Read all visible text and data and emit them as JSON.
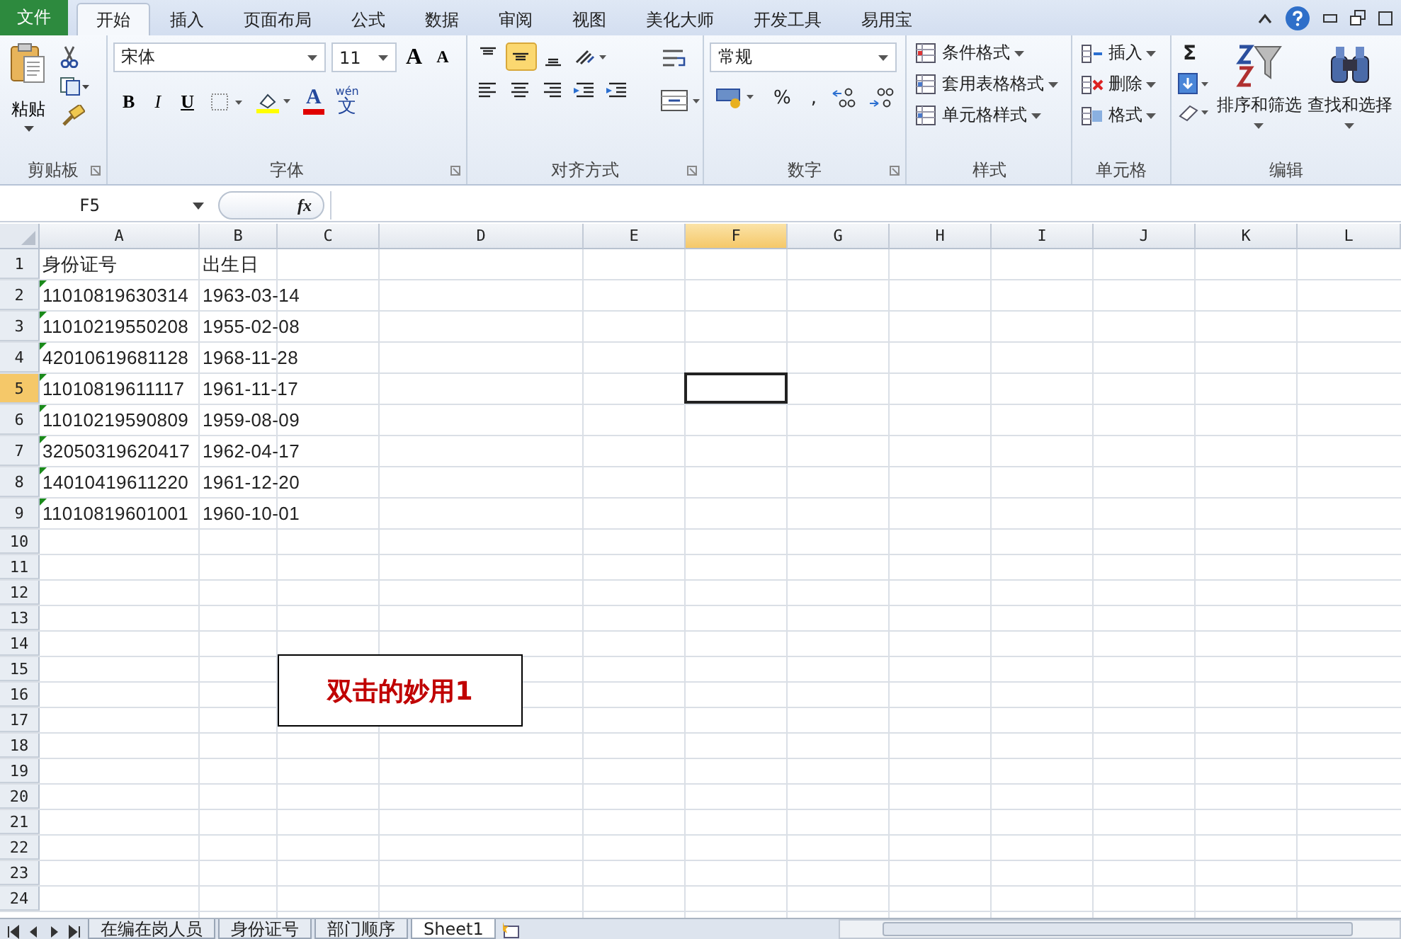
{
  "menu_tabs": [
    {
      "label": "文件",
      "kind": "file",
      "selected": false
    },
    {
      "label": "开始",
      "kind": "tab",
      "selected": true
    },
    {
      "label": "插入",
      "kind": "tab",
      "selected": false
    },
    {
      "label": "页面布局",
      "kind": "tab",
      "selected": false
    },
    {
      "label": "公式",
      "kind": "tab",
      "selected": false
    },
    {
      "label": "数据",
      "kind": "tab",
      "selected": false
    },
    {
      "label": "审阅",
      "kind": "tab",
      "selected": false
    },
    {
      "label": "视图",
      "kind": "tab",
      "selected": false
    },
    {
      "label": "美化大师",
      "kind": "tab",
      "selected": false
    },
    {
      "label": "开发工具",
      "kind": "tab",
      "selected": false
    },
    {
      "label": "易用宝",
      "kind": "tab",
      "selected": false
    }
  ],
  "ribbon": {
    "clipboard": {
      "paste": "粘贴",
      "label": "剪贴板"
    },
    "font": {
      "font_name": "宋体",
      "font_size": "11",
      "grow_shrink": [
        "A",
        "A"
      ],
      "style_buttons": [
        "B",
        "I",
        "U"
      ],
      "font_color_letter": "A",
      "phonetic_top": "wén",
      "phonetic_char": "文",
      "label": "字体"
    },
    "alignment": {
      "rows": [
        [
          {
            "kind": "top",
            "selected": false
          },
          {
            "kind": "middle",
            "selected": true
          },
          {
            "kind": "bottom",
            "selected": false
          },
          {
            "kind": "orientation",
            "selected": false
          }
        ],
        [
          {
            "kind": "left",
            "selected": false
          },
          {
            "kind": "center",
            "selected": false
          },
          {
            "kind": "right",
            "selected": false
          },
          {
            "kind": "outdent",
            "selected": false
          },
          {
            "kind": "indent",
            "selected": false
          }
        ]
      ],
      "label": "对齐方式"
    },
    "number": {
      "format": "常规",
      "symbols": [
        "%",
        ","
      ],
      "label": "数字"
    },
    "styles": {
      "items": [
        "条件格式",
        "套用表格格式",
        "单元格样式"
      ],
      "label": "样式"
    },
    "cells": {
      "items": [
        "插入",
        "删除",
        "格式"
      ],
      "label": "单元格"
    },
    "editing": {
      "sigma": "Σ",
      "items": [
        "排序和筛选",
        "查找和选择"
      ],
      "label": "编辑"
    }
  },
  "formula_bar": {
    "name_box": "F5",
    "fx": "fx"
  },
  "columns": [
    "A",
    "B",
    "C",
    "D",
    "E",
    "F",
    "G",
    "H",
    "I",
    "J",
    "K",
    "L"
  ],
  "rows": [
    {
      "header": "1",
      "cells": [
        "身份证号",
        "出生日"
      ],
      "flag": false
    },
    {
      "header": "2",
      "cells": [
        "11010819630314",
        "1963-03-14"
      ],
      "flag": true
    },
    {
      "header": "3",
      "cells": [
        "11010219550208",
        "1955-02-08"
      ],
      "flag": true
    },
    {
      "header": "4",
      "cells": [
        "42010619681128",
        "1968-11-28"
      ],
      "flag": true
    },
    {
      "header": "5",
      "cells": [
        "11010819611117",
        "1961-11-17"
      ],
      "flag": true
    },
    {
      "header": "6",
      "cells": [
        "11010219590809",
        "1959-08-09"
      ],
      "flag": true
    },
    {
      "header": "7",
      "cells": [
        "32050319620417",
        "1962-04-17"
      ],
      "flag": true
    },
    {
      "header": "8",
      "cells": [
        "14010419611220",
        "1961-12-20"
      ],
      "flag": true
    },
    {
      "header": "9",
      "cells": [
        "11010819601001",
        "1960-10-01"
      ],
      "flag": true
    },
    {
      "header": "10"
    },
    {
      "header": "11"
    },
    {
      "header": "12"
    },
    {
      "header": "13"
    },
    {
      "header": "14"
    },
    {
      "header": "15"
    },
    {
      "header": "16"
    },
    {
      "header": "17"
    },
    {
      "header": "18"
    },
    {
      "header": "19"
    },
    {
      "header": "20"
    },
    {
      "header": "21"
    },
    {
      "header": "22"
    },
    {
      "header": "23"
    },
    {
      "header": "24"
    }
  ],
  "text_box": "双击的妙用1",
  "sheet_tabs": [
    {
      "label": "在编在岗人员",
      "selected": false
    },
    {
      "label": "身份证号",
      "selected": false
    },
    {
      "label": "部门顺序",
      "selected": false
    },
    {
      "label": "Sheet1",
      "selected": true
    }
  ]
}
